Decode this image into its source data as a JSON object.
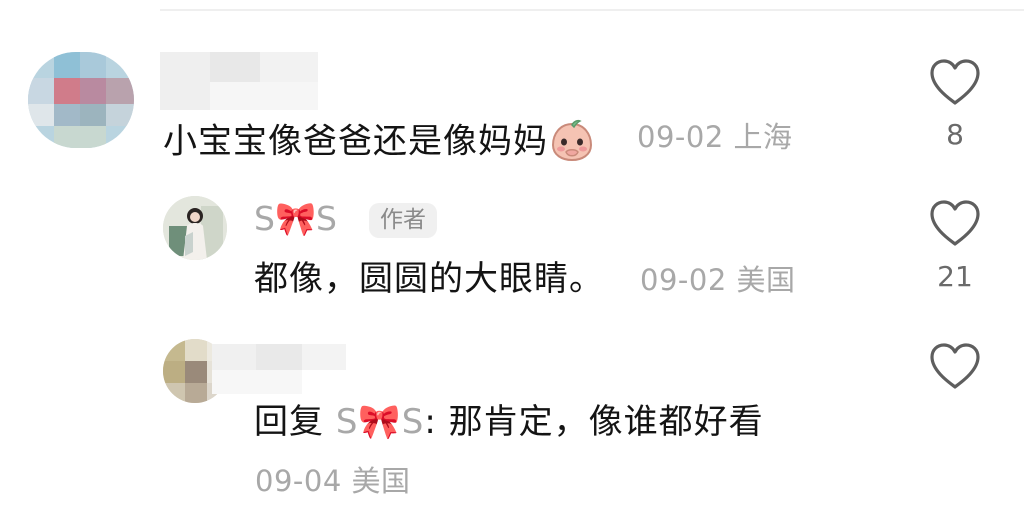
{
  "comments": [
    {
      "text": "小宝宝像爸爸还是像妈妈",
      "emoji": "peach-face-emoji",
      "date": "09-02",
      "location": "上海",
      "likes": "8"
    },
    {
      "author": "S🎀S",
      "author_badge": "作者",
      "text": "都像，圆圆的大眼睛。",
      "date": "09-02",
      "location": "美国",
      "likes": "21"
    },
    {
      "reply_prefix": "回复",
      "reply_to": "S🎀S",
      "text": ": 那肯定，像谁都好看",
      "date": "09-04",
      "location": "美国",
      "likes": ""
    }
  ],
  "colors": {
    "text": "#141414",
    "meta": "#a8a8a8",
    "badge_bg": "#f0f0f0",
    "heart_outline": "#6a6a6a"
  },
  "icons": {
    "like": "heart-outline-icon",
    "bow": "pink-bow-emoji"
  }
}
